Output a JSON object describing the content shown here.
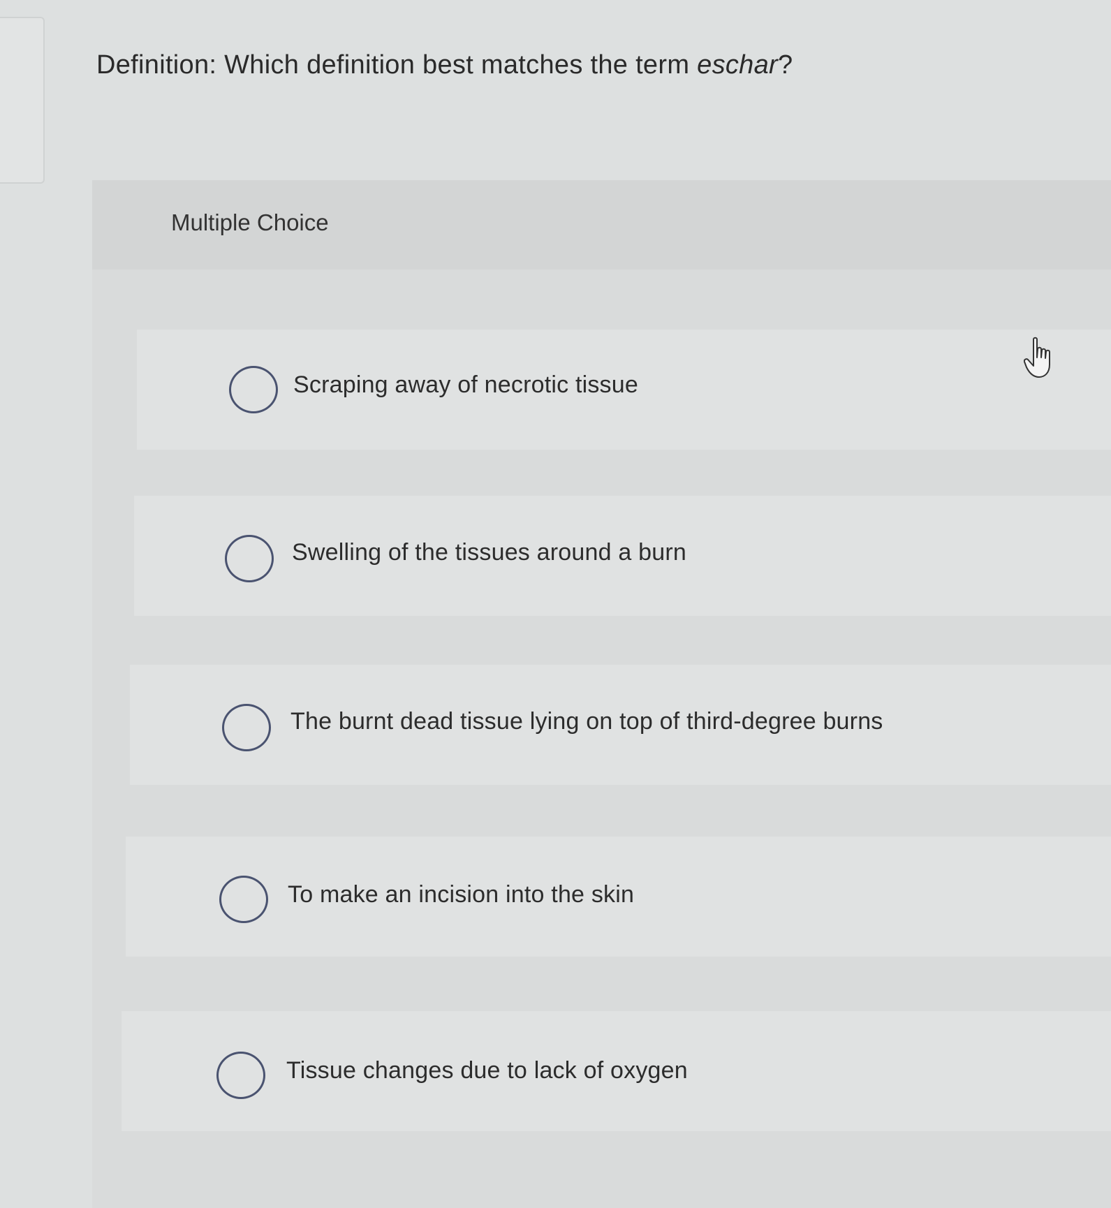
{
  "question": {
    "prefix": "Definition: Which definition best matches the term ",
    "term": "eschar",
    "suffix": "?"
  },
  "panel": {
    "title": "Multiple Choice"
  },
  "options": [
    {
      "label": "Scraping away of necrotic tissue",
      "selected": false
    },
    {
      "label": "Swelling of the tissues around a burn",
      "selected": false
    },
    {
      "label": "The burnt dead tissue lying on top of third-degree burns",
      "selected": false
    },
    {
      "label": "To make an incision into the skin",
      "selected": false
    },
    {
      "label": "Tissue changes due to lack of oxygen",
      "selected": false
    }
  ],
  "cursor": {
    "icon": "hand-pointer-icon"
  },
  "colors": {
    "radio_border": "#4a5370",
    "background": "#dde0e0"
  }
}
